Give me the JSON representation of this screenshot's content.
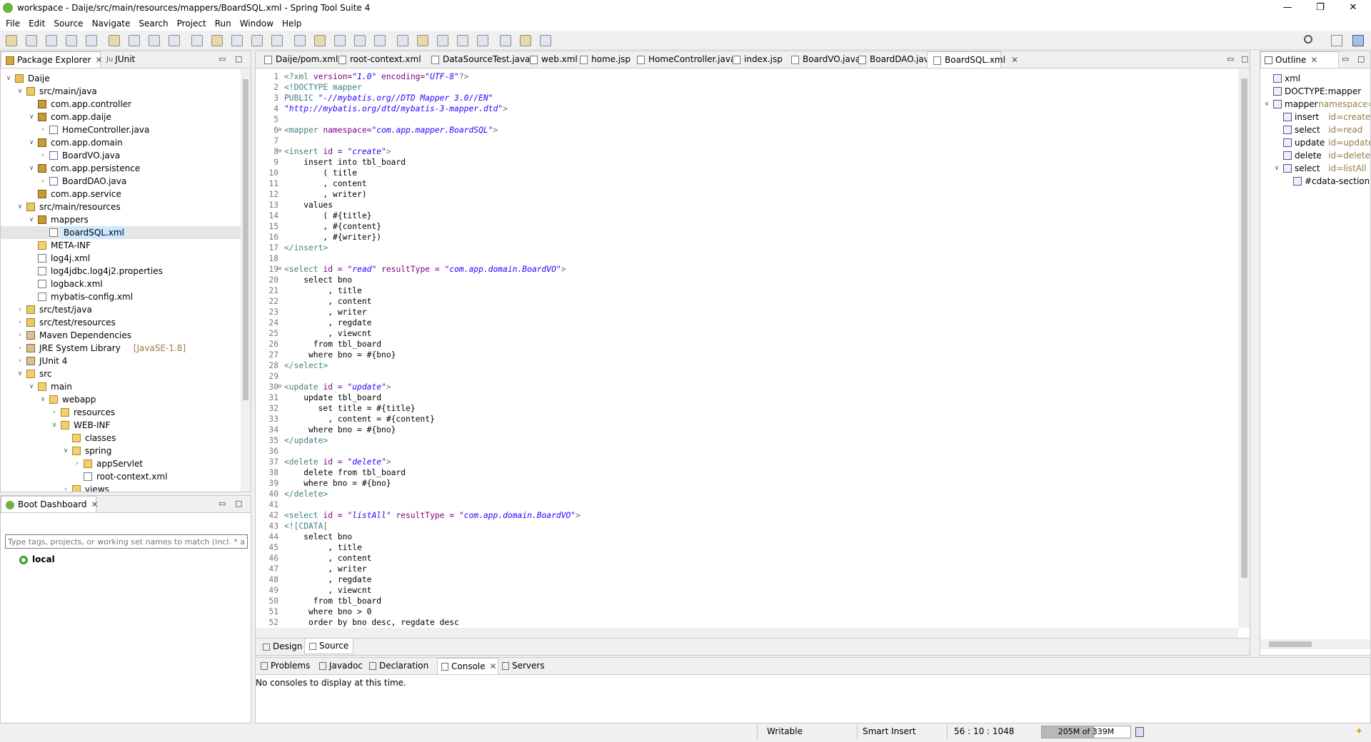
{
  "window": {
    "title": "workspace - Daije/src/main/resources/mappers/BoardSQL.xml - Spring Tool Suite 4",
    "controls": [
      "—",
      "❐",
      "✕"
    ]
  },
  "menu": [
    "File",
    "Edit",
    "Source",
    "Navigate",
    "Search",
    "Project",
    "Run",
    "Window",
    "Help"
  ],
  "left_panel": {
    "tabs": [
      "Package Explorer",
      "JUnit"
    ],
    "tree": [
      {
        "label": "Daije",
        "depth": 0,
        "twisty": "open",
        "icon": "project-icon"
      },
      {
        "label": "src/main/java",
        "depth": 1,
        "twisty": "open",
        "icon": "source-folder-icon"
      },
      {
        "label": "com.app.controller",
        "depth": 2,
        "twisty": "none",
        "icon": "package-icon"
      },
      {
        "label": "com.app.daije",
        "depth": 2,
        "twisty": "open",
        "icon": "package-icon"
      },
      {
        "label": "HomeController.java",
        "depth": 3,
        "twisty": "closed",
        "icon": "java-file-icon"
      },
      {
        "label": "com.app.domain",
        "depth": 2,
        "twisty": "open",
        "icon": "package-icon"
      },
      {
        "label": "BoardVO.java",
        "depth": 3,
        "twisty": "closed",
        "icon": "java-file-icon"
      },
      {
        "label": "com.app.persistence",
        "depth": 2,
        "twisty": "open",
        "icon": "package-icon"
      },
      {
        "label": "BoardDAO.java",
        "depth": 3,
        "twisty": "closed",
        "icon": "java-interface-file-icon"
      },
      {
        "label": "com.app.service",
        "depth": 2,
        "twisty": "none",
        "icon": "package-icon"
      },
      {
        "label": "src/main/resources",
        "depth": 1,
        "twisty": "open",
        "icon": "source-folder-icon"
      },
      {
        "label": "mappers",
        "depth": 2,
        "twisty": "open",
        "icon": "package-icon"
      },
      {
        "label": "BoardSQL.xml",
        "depth": 3,
        "twisty": "none",
        "icon": "xml-file-icon",
        "selected": true
      },
      {
        "label": "META-INF",
        "depth": 2,
        "twisty": "none",
        "icon": "folder-icon"
      },
      {
        "label": "log4j.xml",
        "depth": 2,
        "twisty": "none",
        "icon": "xml-file-icon"
      },
      {
        "label": "log4jdbc.log4j2.properties",
        "depth": 2,
        "twisty": "none",
        "icon": "file-icon"
      },
      {
        "label": "logback.xml",
        "depth": 2,
        "twisty": "none",
        "icon": "xml-file-icon"
      },
      {
        "label": "mybatis-config.xml",
        "depth": 2,
        "twisty": "none",
        "icon": "xml-file-icon"
      },
      {
        "label": "src/test/java",
        "depth": 1,
        "twisty": "closed",
        "icon": "source-folder-icon"
      },
      {
        "label": "src/test/resources",
        "depth": 1,
        "twisty": "closed",
        "icon": "source-folder-icon"
      },
      {
        "label": "Maven Dependencies",
        "depth": 1,
        "twisty": "closed",
        "icon": "library-icon"
      },
      {
        "label": "JRE System Library",
        "suffix": "[JavaSE-1.8]",
        "depth": 1,
        "twisty": "closed",
        "icon": "library-icon"
      },
      {
        "label": "JUnit 4",
        "depth": 1,
        "twisty": "closed",
        "icon": "library-icon"
      },
      {
        "label": "src",
        "depth": 1,
        "twisty": "open",
        "icon": "folder-icon"
      },
      {
        "label": "main",
        "depth": 2,
        "twisty": "open",
        "icon": "folder-icon"
      },
      {
        "label": "webapp",
        "depth": 3,
        "twisty": "open",
        "icon": "folder-icon"
      },
      {
        "label": "resources",
        "depth": 4,
        "twisty": "closed",
        "icon": "folder-icon"
      },
      {
        "label": "WEB-INF",
        "depth": 4,
        "twisty": "open",
        "icon": "folder-icon"
      },
      {
        "label": "classes",
        "depth": 5,
        "twisty": "none",
        "icon": "folder-icon"
      },
      {
        "label": "spring",
        "depth": 5,
        "twisty": "open",
        "icon": "folder-icon"
      },
      {
        "label": "appServlet",
        "depth": 6,
        "twisty": "closed",
        "icon": "folder-icon"
      },
      {
        "label": "root-context.xml",
        "depth": 6,
        "twisty": "none",
        "icon": "xml-file-icon"
      },
      {
        "label": "views",
        "depth": 5,
        "twisty": "closed",
        "icon": "folder-icon"
      }
    ]
  },
  "boot_dashboard": {
    "tab": "Boot Dashboard",
    "filter_placeholder": "Type tags, projects, or working set names to match (incl. * and",
    "item": "local"
  },
  "editor": {
    "tabs": [
      "Daije/pom.xml",
      "root-context.xml",
      "DataSourceTest.java",
      "web.xml",
      "home.jsp",
      "HomeController.java",
      "index.jsp",
      "BoardVO.java",
      "BoardDAO.java",
      "BoardSQL.xml"
    ],
    "active_tab": "BoardSQL.xml",
    "bottom_tabs": [
      "Design",
      "Source"
    ],
    "lines": [
      {
        "n": "1",
        "segs": [
          [
            "t-tag",
            "<?xml "
          ],
          [
            "t-attr",
            "version="
          ],
          [
            "t-str",
            "\"1.0\""
          ],
          [
            "t-attr",
            " encoding="
          ],
          [
            "t-str",
            "\"UTF-8\""
          ],
          [
            "t-tag",
            "?>"
          ]
        ]
      },
      {
        "n": "2",
        "segs": [
          [
            "t-tag",
            "<!DOCTYPE mapper"
          ]
        ]
      },
      {
        "n": "3",
        "segs": [
          [
            "t-tag",
            "PUBLIC "
          ],
          [
            "t-str",
            "\"-//mybatis.org//DTD Mapper 3.0//EN\""
          ]
        ]
      },
      {
        "n": "4",
        "segs": [
          [
            "t-str",
            "\"http://mybatis.org/dtd/mybatis-3-mapper.dtd\""
          ],
          [
            "t-tag",
            ">"
          ]
        ]
      },
      {
        "n": "5",
        "segs": []
      },
      {
        "n": "6",
        "fold": true,
        "segs": [
          [
            "t-tag",
            "<mapper "
          ],
          [
            "t-attr",
            "namespace="
          ],
          [
            "t-str",
            "\"com.app.mapper.BoardSQL\""
          ],
          [
            "t-tag",
            ">"
          ]
        ]
      },
      {
        "n": "7",
        "segs": []
      },
      {
        "n": "8",
        "fold": true,
        "segs": [
          [
            "t-tag",
            "<insert "
          ],
          [
            "t-attr",
            "id = "
          ],
          [
            "t-str",
            "\"create\""
          ],
          [
            "t-tag",
            ">"
          ]
        ]
      },
      {
        "n": "9",
        "segs": [
          [
            "",
            "    insert into tbl_board"
          ]
        ]
      },
      {
        "n": "10",
        "segs": [
          [
            "",
            "        ( title"
          ]
        ]
      },
      {
        "n": "11",
        "segs": [
          [
            "",
            "        , content"
          ]
        ]
      },
      {
        "n": "12",
        "segs": [
          [
            "",
            "        , writer)"
          ]
        ]
      },
      {
        "n": "13",
        "segs": [
          [
            "",
            "    values"
          ]
        ]
      },
      {
        "n": "14",
        "segs": [
          [
            "",
            "        ( #{title}"
          ]
        ]
      },
      {
        "n": "15",
        "segs": [
          [
            "",
            "        , #{content}"
          ]
        ]
      },
      {
        "n": "16",
        "segs": [
          [
            "",
            "        , #{writer})"
          ]
        ]
      },
      {
        "n": "17",
        "segs": [
          [
            "t-tag",
            "</insert>"
          ]
        ]
      },
      {
        "n": "18",
        "segs": []
      },
      {
        "n": "19",
        "fold": true,
        "segs": [
          [
            "t-tag",
            "<select "
          ],
          [
            "t-attr",
            "id = "
          ],
          [
            "t-str",
            "\"read\""
          ],
          [
            "t-attr",
            " resultType = "
          ],
          [
            "t-str",
            "\"com.app.domain.BoardVO\""
          ],
          [
            "t-tag",
            ">"
          ]
        ]
      },
      {
        "n": "20",
        "segs": [
          [
            "",
            "    select bno"
          ]
        ]
      },
      {
        "n": "21",
        "segs": [
          [
            "",
            "         , title"
          ]
        ]
      },
      {
        "n": "22",
        "segs": [
          [
            "",
            "         , content"
          ]
        ]
      },
      {
        "n": "23",
        "segs": [
          [
            "",
            "         , writer"
          ]
        ]
      },
      {
        "n": "24",
        "segs": [
          [
            "",
            "         , regdate"
          ]
        ]
      },
      {
        "n": "25",
        "segs": [
          [
            "",
            "         , viewcnt"
          ]
        ]
      },
      {
        "n": "26",
        "segs": [
          [
            "",
            "      from tbl_board"
          ]
        ]
      },
      {
        "n": "27",
        "segs": [
          [
            "",
            "     where bno = #{bno}"
          ]
        ]
      },
      {
        "n": "28",
        "segs": [
          [
            "t-tag",
            "</select>"
          ]
        ]
      },
      {
        "n": "29",
        "segs": []
      },
      {
        "n": "30",
        "fold": true,
        "segs": [
          [
            "t-tag",
            "<update "
          ],
          [
            "t-attr",
            "id = "
          ],
          [
            "t-str",
            "\"update\""
          ],
          [
            "t-tag",
            ">"
          ]
        ]
      },
      {
        "n": "31",
        "segs": [
          [
            "",
            "    update tbl_board"
          ]
        ]
      },
      {
        "n": "32",
        "segs": [
          [
            "",
            "       set title = #{title}"
          ]
        ]
      },
      {
        "n": "33",
        "segs": [
          [
            "",
            "         , content = #{content}"
          ]
        ]
      },
      {
        "n": "34",
        "segs": [
          [
            "",
            "     where bno = #{bno}"
          ]
        ]
      },
      {
        "n": "35",
        "segs": [
          [
            "t-tag",
            "</update>"
          ]
        ]
      },
      {
        "n": "36",
        "segs": []
      },
      {
        "n": "37",
        "segs": [
          [
            "t-tag",
            "<delete "
          ],
          [
            "t-attr",
            "id = "
          ],
          [
            "t-str",
            "\"delete\""
          ],
          [
            "t-tag",
            ">"
          ]
        ]
      },
      {
        "n": "38",
        "segs": [
          [
            "",
            "    delete from tbl_board"
          ]
        ]
      },
      {
        "n": "39",
        "segs": [
          [
            "",
            "    where bno = #{bno}"
          ]
        ]
      },
      {
        "n": "40",
        "segs": [
          [
            "t-tag",
            "</delete>"
          ]
        ]
      },
      {
        "n": "41",
        "segs": []
      },
      {
        "n": "42",
        "segs": [
          [
            "t-tag",
            "<select "
          ],
          [
            "t-attr",
            "id = "
          ],
          [
            "t-str",
            "\"listAll\""
          ],
          [
            "t-attr",
            " resultType = "
          ],
          [
            "t-str",
            "\"com.app.domain.BoardVO\""
          ],
          [
            "t-tag",
            ">"
          ]
        ]
      },
      {
        "n": "43",
        "segs": [
          [
            "t-cdata",
            "<![CDATA["
          ]
        ]
      },
      {
        "n": "44",
        "segs": [
          [
            "",
            "    select bno"
          ]
        ]
      },
      {
        "n": "45",
        "segs": [
          [
            "",
            "         , title"
          ]
        ]
      },
      {
        "n": "46",
        "segs": [
          [
            "",
            "         , content"
          ]
        ]
      },
      {
        "n": "47",
        "segs": [
          [
            "",
            "         , writer"
          ]
        ]
      },
      {
        "n": "48",
        "segs": [
          [
            "",
            "         , regdate"
          ]
        ]
      },
      {
        "n": "49",
        "segs": [
          [
            "",
            "         , viewcnt"
          ]
        ]
      },
      {
        "n": "50",
        "segs": [
          [
            "",
            "      from tbl_board"
          ]
        ]
      },
      {
        "n": "51",
        "segs": [
          [
            "",
            "     where bno > 0"
          ]
        ]
      },
      {
        "n": "52",
        "segs": [
          [
            "",
            "     order by bno desc, regdate desc"
          ]
        ]
      }
    ]
  },
  "outline": {
    "tab": "Outline",
    "items": [
      {
        "label": "xml",
        "attr": "",
        "depth": 0,
        "twisty": "none",
        "icon": "?-?"
      },
      {
        "label": "DOCTYPE:mapper",
        "attr": "",
        "depth": 0,
        "twisty": "none",
        "icon": "doc"
      },
      {
        "label": "mapper",
        "attr": "namespace=com.app.mapper.BoardSQL",
        "depth": 0,
        "twisty": "open",
        "icon": "e"
      },
      {
        "label": "insert",
        "attr": "id=create",
        "depth": 1,
        "twisty": "none",
        "icon": "e"
      },
      {
        "label": "select",
        "attr": "id=read",
        "depth": 1,
        "twisty": "none",
        "icon": "e"
      },
      {
        "label": "update",
        "attr": "id=update",
        "depth": 1,
        "twisty": "none",
        "icon": "e"
      },
      {
        "label": "delete",
        "attr": "id=delete",
        "depth": 1,
        "twisty": "none",
        "icon": "e"
      },
      {
        "label": "select",
        "attr": "id=listAll",
        "depth": 1,
        "twisty": "open",
        "icon": "e"
      },
      {
        "label": "#cdata-section",
        "attr": "",
        "depth": 2,
        "twisty": "none",
        "icon": "cdata"
      }
    ]
  },
  "console": {
    "tabs": [
      "Problems",
      "Javadoc",
      "Declaration",
      "Console",
      "Servers"
    ],
    "active": "Console",
    "message": "No consoles to display at this time."
  },
  "status": {
    "writable": "Writable",
    "insert_mode": "Smart Insert",
    "position": "56 : 10 : 1048",
    "heap": "205M of 339M",
    "heap_fraction": 0.6
  },
  "colors": {
    "tag": "#3f7f7f",
    "attr": "#7f007f",
    "string": "#2a00ff",
    "selection": "#cde8ff",
    "brand": "#6db33f"
  }
}
